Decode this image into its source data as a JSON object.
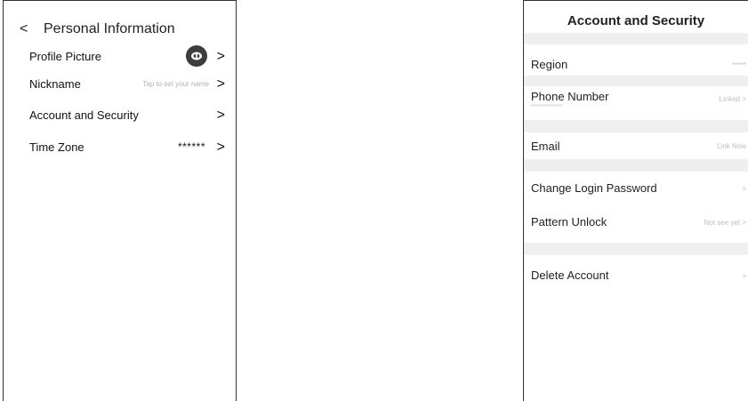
{
  "left": {
    "back_label": "<",
    "title": "Personal Information",
    "rows": [
      {
        "label": "Profile Picture",
        "value": "",
        "chevron": ">"
      },
      {
        "label": "Nickname",
        "value": "Tap to set your name",
        "chevron": ">"
      },
      {
        "label": "Account and Security",
        "value": "",
        "chevron": ">"
      },
      {
        "label": "Time Zone",
        "value": "******",
        "chevron": ">"
      }
    ]
  },
  "right": {
    "title": "Account and Security",
    "rows": [
      {
        "label": "Region",
        "value": "*****"
      },
      {
        "label": "Phone Number",
        "value": "Linked >",
        "sub": "*************"
      },
      {
        "label": "Email",
        "value": "Link Now"
      },
      {
        "label": "Change Login Password",
        "value": ">"
      },
      {
        "label": "Pattern Unlock",
        "value": "Not see yet >"
      },
      {
        "label": "Delete Account",
        "value": ">"
      }
    ]
  },
  "colors": {
    "gap_bar": "#efefef",
    "avatar": "#3d3d3d",
    "hint_text": "#bdbdbd"
  }
}
